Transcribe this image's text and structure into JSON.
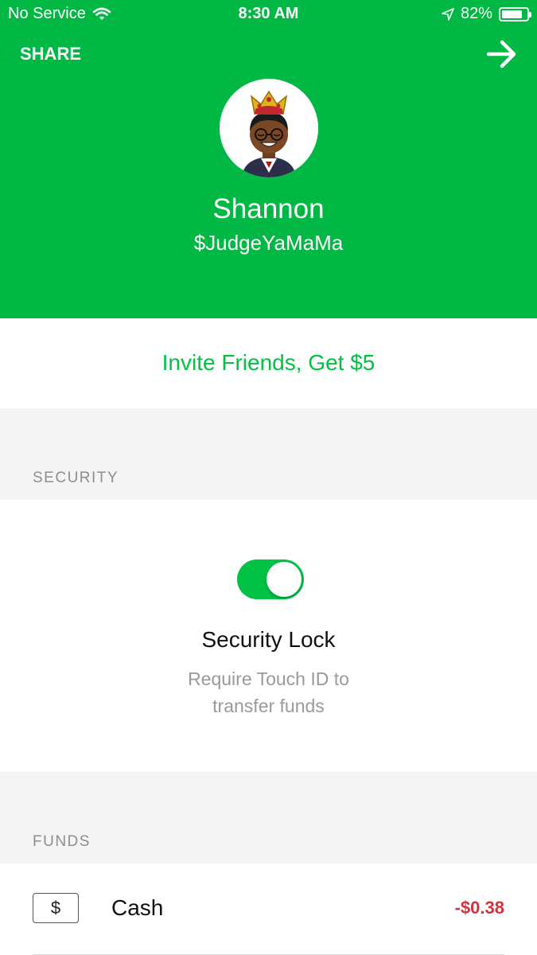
{
  "status_bar": {
    "carrier": "No Service",
    "time": "8:30 AM",
    "battery": "82%",
    "battery_level": 0.82
  },
  "header": {
    "share_label": "SHARE",
    "name": "Shannon",
    "cashtag": "$JudgeYaMaMa"
  },
  "invite": {
    "label": "Invite Friends, Get $5"
  },
  "security": {
    "section_label": "SECURITY",
    "toggle_on": true,
    "title": "Security Lock",
    "description_line1": "Require Touch ID to",
    "description_line2": "transfer funds"
  },
  "funds": {
    "section_label": "FUNDS",
    "items": [
      {
        "icon_text": "$",
        "label": "Cash",
        "amount": "-$0.38"
      }
    ]
  },
  "colors": {
    "brand_green": "#00b843",
    "accent_green": "#00c244",
    "negative_red": "#d0333d"
  }
}
